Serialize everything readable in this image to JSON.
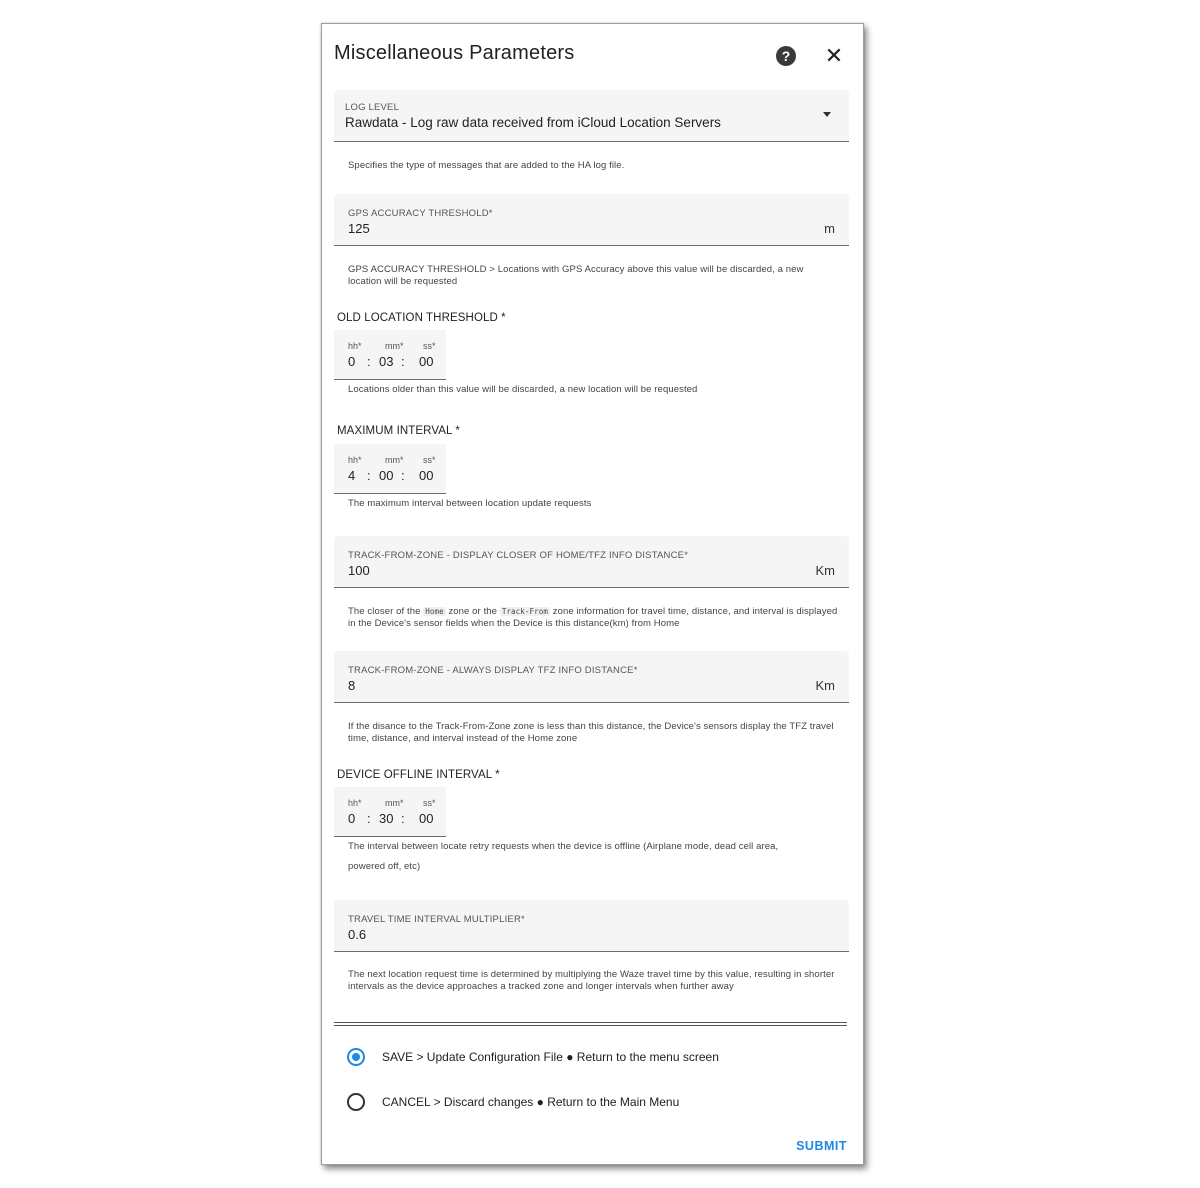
{
  "dialog": {
    "title": "Miscellaneous Parameters",
    "help_icon": "question-circle-icon",
    "close_icon": "close-icon",
    "help_glyph": "?",
    "close_glyph": "✕"
  },
  "log_level": {
    "label": "LOG LEVEL",
    "value": "Rawdata - Log raw data received from iCloud Location Servers",
    "helper": "Specifies the type of messages that are added to the HA log file."
  },
  "gps_accuracy": {
    "label": "GPS ACCURACY THRESHOLD*",
    "value": "125",
    "suffix": "m",
    "helper": "GPS ACCURACY THRESHOLD > Locations with GPS Accuracy above this value will be discarded, a new location will be requested"
  },
  "old_location": {
    "title": "OLD LOCATION THRESHOLD *",
    "hh_label": "hh*",
    "mm_label": "mm*",
    "ss_label": "ss*",
    "hh": "0",
    "mm": "03",
    "ss": "00",
    "helper": "Locations older than this value will be discarded, a new location will be requested"
  },
  "max_interval": {
    "title": "MAXIMUM INTERVAL *",
    "hh_label": "hh*",
    "mm_label": "mm*",
    "ss_label": "ss*",
    "hh": "4",
    "mm": "00",
    "ss": "00",
    "helper": "The maximum interval between location update requests"
  },
  "tfz_closer": {
    "label": "TRACK-FROM-ZONE - DISPLAY CLOSER OF HOME/TFZ INFO DISTANCE*",
    "value": "100",
    "suffix": "Km",
    "helper_a": "The closer of the",
    "helper_code1": "Home",
    "helper_b": "zone or the",
    "helper_code2": "Track-From",
    "helper_c": "zone information for travel time, distance, and interval is displayed in the Device's sensor fields when the Device is this distance(km) from Home"
  },
  "tfz_always": {
    "label": "TRACK-FROM-ZONE - ALWAYS DISPLAY TFZ INFO DISTANCE*",
    "value": "8",
    "suffix": "Km",
    "helper": "If the disance to the Track-From-Zone zone is less than this distance, the Device's sensors display the TFZ travel time, distance, and interval instead of the Home zone"
  },
  "offline_interval": {
    "title": "DEVICE OFFLINE INTERVAL *",
    "hh_label": "hh*",
    "mm_label": "mm*",
    "ss_label": "ss*",
    "hh": "0",
    "mm": "30",
    "ss": "00",
    "helper_line1": "The interval between locate retry requests when the device is offline (Airplane mode, dead cell area,",
    "helper_line2": "powered off, etc)"
  },
  "travel_multiplier": {
    "label": "TRAVEL TIME INTERVAL MULTIPLIER*",
    "value": "0.6",
    "helper": "The next location request time is determined by multiplying the Waze travel time by this value, resulting in shorter intervals as the device approaches a tracked zone and longer intervals when further away"
  },
  "actions": {
    "save_label": "SAVE > Update Configuration File ● Return to the menu screen",
    "save_selected": true,
    "cancel_label": "CANCEL > Discard changes ● Return to the Main Menu",
    "cancel_selected": false,
    "submit_label": "SUBMIT"
  },
  "colors": {
    "accent": "#1e88e5",
    "field_bg": "#f5f5f5"
  }
}
